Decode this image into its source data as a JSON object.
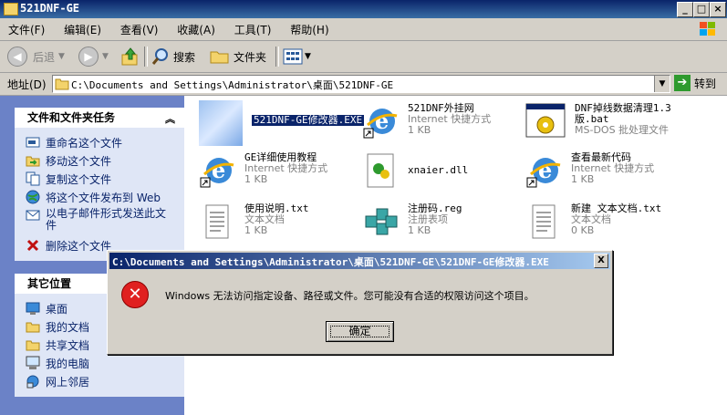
{
  "window": {
    "title": "521DNF-GE"
  },
  "menu": [
    "文件(F)",
    "编辑(E)",
    "查看(V)",
    "收藏(A)",
    "工具(T)",
    "帮助(H)"
  ],
  "toolbar": {
    "back": "后退",
    "search": "搜索",
    "folders": "文件夹"
  },
  "address": {
    "label": "地址(D)",
    "path": "C:\\Documents and Settings\\Administrator\\桌面\\521DNF-GE",
    "go": "转到"
  },
  "tasks": {
    "header": "文件和文件夹任务",
    "items": [
      "重命名这个文件",
      "移动这个文件",
      "复制这个文件",
      "将这个文件发布到 Web",
      "以电子邮件形式发送此文件",
      "删除这个文件"
    ]
  },
  "places": {
    "header": "其它位置",
    "items": [
      "桌面",
      "我的文档",
      "共享文档",
      "我的电脑",
      "网上邻居"
    ]
  },
  "files": [
    {
      "name": "521DNF-GE修改器.EXE",
      "type": "",
      "size": ""
    },
    {
      "name": "521DNF外挂网",
      "type": "Internet 快捷方式",
      "size": "1 KB"
    },
    {
      "name": "DNF掉线数据清理1.3版.bat",
      "type": "MS-DOS 批处理文件",
      "size": ""
    },
    {
      "name": "GE详细使用教程",
      "type": "Internet 快捷方式",
      "size": "1 KB"
    },
    {
      "name": "xnaier.dll",
      "type": "",
      "size": ""
    },
    {
      "name": "查看最新代码",
      "type": "Internet 快捷方式",
      "size": "1 KB"
    },
    {
      "name": "使用说明.txt",
      "type": "文本文档",
      "size": "1 KB"
    },
    {
      "name": "注册码.reg",
      "type": "注册表项",
      "size": "1 KB"
    },
    {
      "name": "新建 文本文档.txt",
      "type": "文本文档",
      "size": "0 KB"
    }
  ],
  "dialog": {
    "title": "C:\\Documents and Settings\\Administrator\\桌面\\521DNF-GE\\521DNF-GE修改器.EXE",
    "message": "Windows 无法访问指定设备、路径或文件。您可能没有合适的权限访问这个项目。",
    "ok": "确定",
    "close": "X"
  }
}
